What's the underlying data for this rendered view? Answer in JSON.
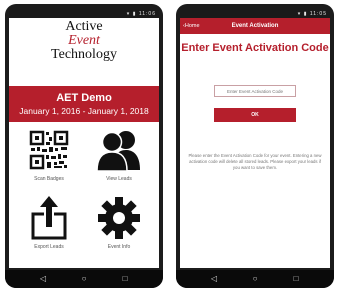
{
  "left_screen": {
    "status_bar": {
      "time": "11:06"
    },
    "logo": {
      "line1": "Active",
      "line2": "Event",
      "line3": "Technology"
    },
    "event": {
      "name": "AET Demo",
      "dates": "January 1, 2016 - January 1, 2018"
    },
    "tiles": [
      {
        "label": "Scan Badges",
        "icon": "qr-code-icon"
      },
      {
        "label": "View Leads",
        "icon": "people-icon"
      },
      {
        "label": "Export Leads",
        "icon": "export-icon"
      },
      {
        "label": "Event Info",
        "icon": "gear-icon"
      }
    ]
  },
  "right_screen": {
    "status_bar": {
      "time": "11:05"
    },
    "app_bar": {
      "back_label": "Home",
      "title": "Event Activation"
    },
    "heading": "Enter Event Activation Code",
    "code_input": {
      "placeholder": "Enter Event Activation Code",
      "value": ""
    },
    "ok_button": "OK",
    "help_text": "Please enter the Event Activation Code for your event. Entering a new activation code will delete all stored leads. Please export your leads if you want to save them."
  },
  "nav_bar": {
    "back": "◁",
    "home": "○",
    "recents": "□"
  },
  "colors": {
    "brand_red": "#b51f2c",
    "black": "#111111"
  }
}
